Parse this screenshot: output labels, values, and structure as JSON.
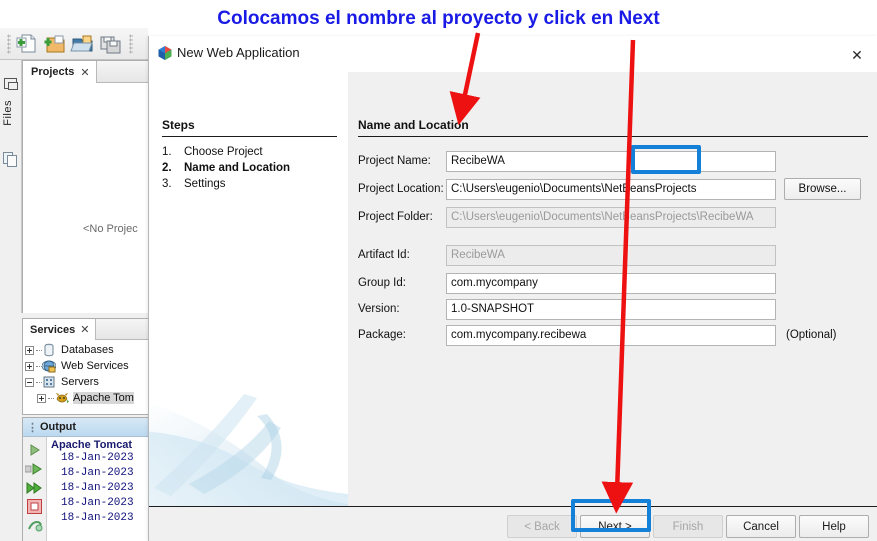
{
  "annotation": {
    "title": "Colocamos el nombre al proyecto y click en Next",
    "title_color": "#1a1ae6",
    "arrow_color": "#ee1111",
    "highlight_color": "#1480d8"
  },
  "ide": {
    "toolbar": {
      "icons": [
        "new-file-icon",
        "new-project-icon",
        "open-project-icon",
        "save-all-icon"
      ]
    },
    "dock": {
      "minimize_label": "minimize-window-icon",
      "files_label": "Files",
      "files_icon": "files-icon"
    },
    "projects_window": {
      "tab_label": "Projects",
      "close_label": "✕",
      "empty_text": "<No Projec"
    },
    "services_window": {
      "tab_label": "Services",
      "close_label": "✕",
      "tree": [
        {
          "label": "Databases",
          "icon": "database-icon",
          "expander": "plus",
          "indent": 0
        },
        {
          "label": "Web Services",
          "icon": "web-services-icon",
          "expander": "plus",
          "indent": 0
        },
        {
          "label": "Servers",
          "icon": "servers-icon",
          "expander": "minus",
          "indent": 0
        },
        {
          "label": "Apache Tom",
          "icon": "tomcat-icon",
          "expander": "plus",
          "indent": 1
        }
      ]
    },
    "output_window": {
      "title": "Output",
      "tab_label": "Apache Tomcat",
      "gutter_icons": [
        "run-icon",
        "rerun-icon",
        "fastforward-icon",
        "stop-icon",
        "gc-icon"
      ],
      "lines": [
        "18-Jan-2023",
        "18-Jan-2023",
        "18-Jan-2023",
        "18-Jan-2023",
        "18-Jan-2023"
      ]
    }
  },
  "dialog": {
    "title": "New Web Application",
    "app_icon": "netbeans-cube-icon",
    "close_label": "✕",
    "steps": {
      "heading": "Steps",
      "items": [
        {
          "num": "1.",
          "label": "Choose Project",
          "current": false
        },
        {
          "num": "2.",
          "label": "Name and Location",
          "current": true
        },
        {
          "num": "3.",
          "label": "Settings",
          "current": false
        }
      ]
    },
    "page": {
      "heading": "Name and Location",
      "fields": [
        {
          "name": "project-name",
          "label": "Project Name:",
          "value": "RecibeWA",
          "readonly": false,
          "trailing": "",
          "button": "",
          "highlight": true
        },
        {
          "name": "project-location",
          "label": "Project Location:",
          "value": "C:\\Users\\eugenio\\Documents\\NetBeansProjects",
          "readonly": false,
          "trailing": "",
          "button": "Browse...",
          "highlight": false
        },
        {
          "name": "project-folder",
          "label": "Project Folder:",
          "value": "C:\\Users\\eugenio\\Documents\\NetBeansProjects\\RecibeWA",
          "readonly": true,
          "trailing": "",
          "button": "",
          "highlight": false
        },
        {
          "name": "artifact-id",
          "label": "Artifact Id:",
          "value": "RecibeWA",
          "readonly": true,
          "trailing": "",
          "button": "",
          "highlight": false
        },
        {
          "name": "group-id",
          "label": "Group Id:",
          "value": "com.mycompany",
          "readonly": false,
          "trailing": "",
          "button": "",
          "highlight": false
        },
        {
          "name": "version",
          "label": "Version:",
          "value": "1.0-SNAPSHOT",
          "readonly": false,
          "trailing": "",
          "button": "",
          "highlight": false
        },
        {
          "name": "package",
          "label": "Package:",
          "value": "com.mycompany.recibewa",
          "readonly": false,
          "trailing": "(Optional)",
          "button": "",
          "highlight": false
        }
      ]
    },
    "buttons": [
      {
        "name": "back-button",
        "label": "< Back",
        "disabled": true,
        "highlight": false
      },
      {
        "name": "next-button",
        "label": "Next >",
        "disabled": false,
        "highlight": true
      },
      {
        "name": "finish-button",
        "label": "Finish",
        "disabled": true,
        "highlight": false
      },
      {
        "name": "cancel-button",
        "label": "Cancel",
        "disabled": false,
        "highlight": false
      },
      {
        "name": "help-button",
        "label": "Help",
        "disabled": false,
        "highlight": false
      }
    ]
  }
}
